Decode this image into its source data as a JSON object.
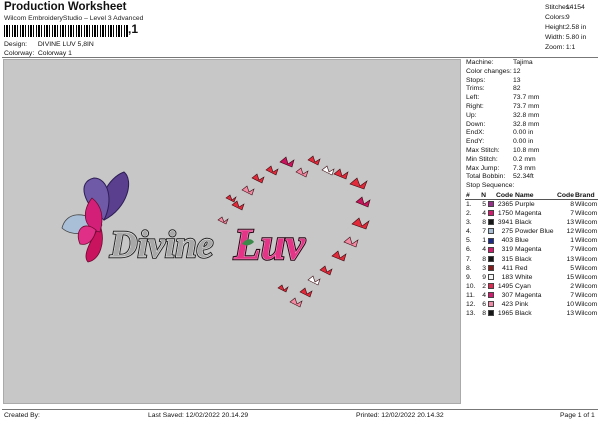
{
  "header": {
    "title": "Production Worksheet",
    "subtitle": "Wilcom EmbroideryStudio – Level 3 Advanced",
    "barcode_mark": ",1",
    "design_label": "Design:",
    "design_value": "DIVINE LUV 5,8IN",
    "colorway_label": "Colorway:",
    "colorway_value": "Colorway 1"
  },
  "stats": [
    {
      "label": "Stitches:",
      "value": "14154"
    },
    {
      "label": "Colors:",
      "value": "9"
    },
    {
      "label": "Height:",
      "value": "2.58 in"
    },
    {
      "label": "Width:",
      "value": "5.80 in"
    },
    {
      "label": "Zoom:",
      "value": "1:1"
    }
  ],
  "design_text": "Divine Luv",
  "machine_info": [
    {
      "label": "Machine:",
      "value": "Tajima"
    },
    {
      "label": "Color changes:",
      "value": "12"
    },
    {
      "label": "Stops:",
      "value": "13"
    },
    {
      "label": "Trims:",
      "value": "82"
    },
    {
      "label": "Left:",
      "value": "73.7 mm"
    },
    {
      "label": "Right:",
      "value": "73.7 mm"
    },
    {
      "label": "Up:",
      "value": "32.8 mm"
    },
    {
      "label": "Down:",
      "value": "32.8 mm"
    },
    {
      "label": "EndX:",
      "value": "0.00 in"
    },
    {
      "label": "EndY:",
      "value": "0.00 in"
    },
    {
      "label": "Max Stitch:",
      "value": "10.8 mm"
    },
    {
      "label": "Min Stitch:",
      "value": "0.2 mm"
    },
    {
      "label": "Max Jump:",
      "value": "7.3 mm"
    },
    {
      "label": "Total Bobbin:",
      "value": "52.34ft"
    }
  ],
  "stop_sequence": {
    "title": "Stop Sequence:",
    "headers": [
      "#",
      "N",
      "Code",
      "Name",
      "Code",
      "Brand"
    ],
    "rows": [
      {
        "idx": "1.",
        "n": "5",
        "color": "#9b2d8c",
        "code": "2365",
        "name": "Purple",
        "cd": "8",
        "brand": "Wilcom"
      },
      {
        "idx": "2.",
        "n": "4",
        "color": "#d4196e",
        "code": "1750",
        "name": "Magenta",
        "cd": "7",
        "brand": "Wilcom"
      },
      {
        "idx": "3.",
        "n": "8",
        "color": "#161616",
        "code": "3941",
        "name": "Black",
        "cd": "13",
        "brand": "Wilcom"
      },
      {
        "idx": "4.",
        "n": "7",
        "color": "#a9bfd8",
        "code": "275",
        "name": "Powder Blue",
        "cd": "12",
        "brand": "Wilcom"
      },
      {
        "idx": "5.",
        "n": "1",
        "color": "#1a2a8c",
        "code": "403",
        "name": "Blue",
        "cd": "1",
        "brand": "Wilcom"
      },
      {
        "idx": "6.",
        "n": "4",
        "color": "#d4196e",
        "code": "319",
        "name": "Magenta",
        "cd": "7",
        "brand": "Wilcom"
      },
      {
        "idx": "7.",
        "n": "8",
        "color": "#161616",
        "code": "315",
        "name": "Black",
        "cd": "13",
        "brand": "Wilcom"
      },
      {
        "idx": "8.",
        "n": "3",
        "color": "#8a1a1a",
        "code": "411",
        "name": "Red",
        "cd": "5",
        "brand": "Wilcom"
      },
      {
        "idx": "9.",
        "n": "9",
        "color": "#f4f4f4",
        "code": "183",
        "name": "White",
        "cd": "15",
        "brand": "Wilcom"
      },
      {
        "idx": "10.",
        "n": "2",
        "color": "#e2294f",
        "code": "1495",
        "name": "Cyan",
        "cd": "2",
        "brand": "Wilcom"
      },
      {
        "idx": "11.",
        "n": "4",
        "color": "#d4196e",
        "code": "307",
        "name": "Magenta",
        "cd": "7",
        "brand": "Wilcom"
      },
      {
        "idx": "12.",
        "n": "6",
        "color": "#f08aa8",
        "code": "423",
        "name": "Pink",
        "cd": "10",
        "brand": "Wilcom"
      },
      {
        "idx": "13.",
        "n": "8",
        "color": "#161616",
        "code": "1965",
        "name": "Black",
        "cd": "13",
        "brand": "Wilcom"
      }
    ]
  },
  "footer": {
    "created": "Created By:",
    "saved": "Last Saved: 12/02/2022 20.14.29",
    "printed": "Printed: 12/02/2022 20.14.32",
    "page": "Page 1 of 1"
  }
}
